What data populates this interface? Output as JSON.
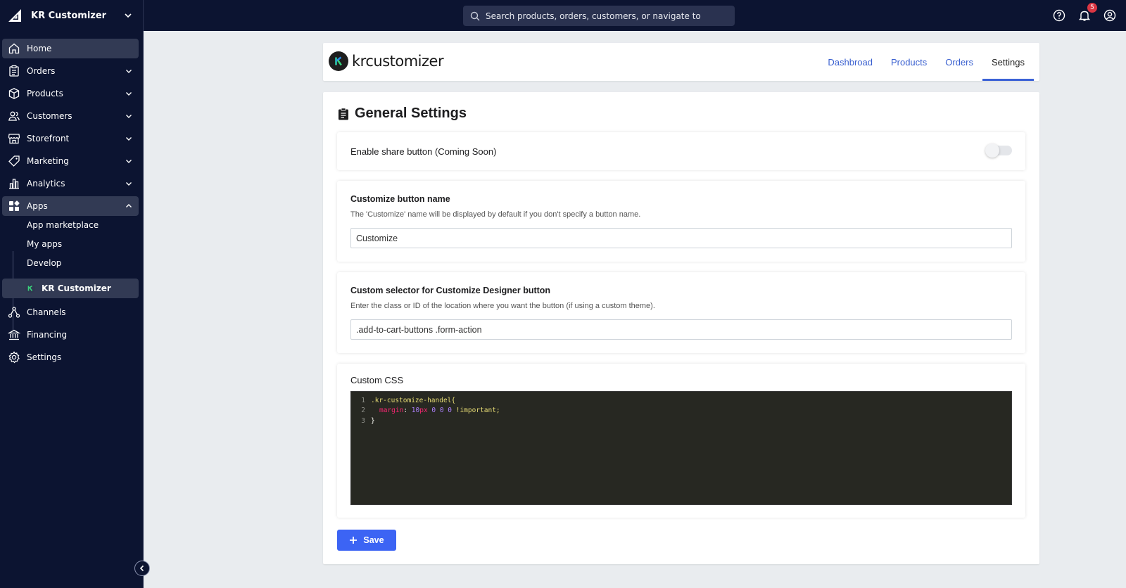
{
  "topbar": {
    "store_name": "KR Customizer",
    "search_placeholder": "Search products, orders, customers, or navigate to",
    "notification_count": "5"
  },
  "sidebar": {
    "items": [
      {
        "label": "Home",
        "icon": "home-icon"
      },
      {
        "label": "Orders",
        "icon": "clipboard-icon"
      },
      {
        "label": "Products",
        "icon": "box-icon"
      },
      {
        "label": "Customers",
        "icon": "users-icon"
      },
      {
        "label": "Storefront",
        "icon": "storefront-icon"
      },
      {
        "label": "Marketing",
        "icon": "tag-icon"
      },
      {
        "label": "Analytics",
        "icon": "bar-chart-icon"
      },
      {
        "label": "Apps",
        "icon": "apps-icon"
      },
      {
        "label": "Channels",
        "icon": "channels-icon"
      },
      {
        "label": "Financing",
        "icon": "bank-icon"
      },
      {
        "label": "Settings",
        "icon": "gear-icon"
      }
    ],
    "apps_sub": [
      {
        "label": "App marketplace"
      },
      {
        "label": "My apps"
      },
      {
        "label": "Develop"
      },
      {
        "label": "KR Customizer"
      }
    ]
  },
  "app_header": {
    "logo_text": "krcustomizer",
    "tabs": [
      {
        "label": "Dashbroad"
      },
      {
        "label": "Products"
      },
      {
        "label": "Orders"
      },
      {
        "label": "Settings",
        "active": true
      }
    ]
  },
  "settings": {
    "title": "General Settings",
    "share": {
      "label": "Enable share button (Coming Soon)",
      "enabled": false
    },
    "button_name": {
      "title": "Customize button name",
      "desc": "The 'Customize' name will be displayed by default if you don't specify a button name.",
      "value": "Customize"
    },
    "selector": {
      "title": "Custom selector for Customize Designer button",
      "desc": "Enter the class or ID of the location where you want the button (if using a custom theme).",
      "value": ".add-to-cart-buttons .form-action"
    },
    "css": {
      "label": "Custom CSS",
      "line_numbers": [
        "1",
        "2",
        "3"
      ],
      "line1_selector": ".kr-customize-handel{",
      "line2_prop": "margin",
      "line2_colon": ": ",
      "line2_num": "10",
      "line2_unit": "px",
      "line2_rest": " 0 0 0 ",
      "line2_imp": "!important;",
      "line3": "}"
    },
    "save_label": "Save"
  },
  "colors": {
    "sidebar_bg": "#0c1431",
    "accent": "#3c64f4",
    "tab_link": "#3a60d0",
    "badge": "#db3643"
  }
}
